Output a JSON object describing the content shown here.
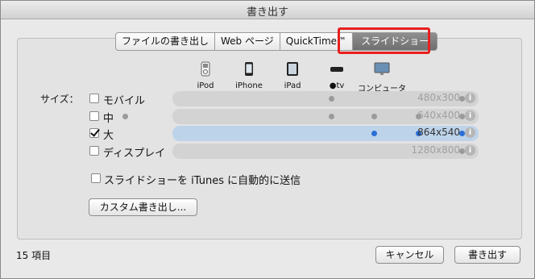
{
  "window": {
    "title": "書き出す"
  },
  "tabs": [
    {
      "label": "ファイルの書き出し"
    },
    {
      "label": "Web ページ"
    },
    {
      "label": "QuickTime™"
    },
    {
      "label": "スライドショー"
    }
  ],
  "devices": [
    {
      "label": "iPod",
      "icon": "ipod-icon"
    },
    {
      "label": "iPhone",
      "icon": "iphone-icon"
    },
    {
      "label": "iPad",
      "icon": "ipad-icon"
    },
    {
      "label": "tv",
      "icon": "apple-tv-icon"
    },
    {
      "label": "コンピュータ",
      "icon": "computer-icon"
    }
  ],
  "size_label": "サイズ：",
  "sizes": [
    {
      "label": "モバイル",
      "checked": false,
      "resolution": "480x300",
      "dots": [
        false,
        true,
        false,
        false,
        true
      ]
    },
    {
      "label": "中",
      "checked": false,
      "resolution": "640x400",
      "dots": [
        true,
        true,
        true,
        true,
        true
      ]
    },
    {
      "label": "大",
      "checked": true,
      "resolution": "864x540",
      "dots": [
        false,
        false,
        true,
        true,
        true
      ]
    },
    {
      "label": "ディスプレイ",
      "checked": false,
      "resolution": "1280x800",
      "dots": [
        false,
        false,
        false,
        false,
        true
      ]
    }
  ],
  "itunes_option": {
    "label": "スライドショーを iTunes に自動的に送信",
    "checked": false
  },
  "custom_export_button": "カスタム書き出し...",
  "item_count": "15 項目",
  "cancel_button": "キャンセル",
  "export_button": "書き出す",
  "colors": {
    "highlight": "#e8201f",
    "selected_row": "#bdd3ea",
    "active_dot": "#2b6fd6"
  }
}
